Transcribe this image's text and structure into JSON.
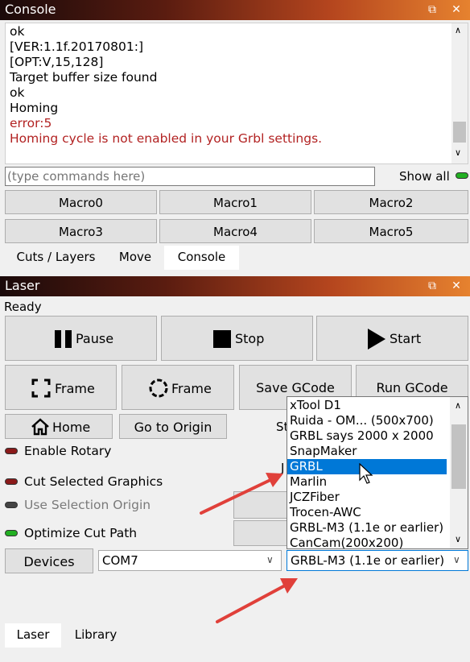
{
  "console": {
    "title": "Console",
    "lines": [
      {
        "text": "ok",
        "color": "#000000"
      },
      {
        "text": "[VER:1.1f.20170801:]",
        "color": "#000000"
      },
      {
        "text": "[OPT:V,15,128]",
        "color": "#000000"
      },
      {
        "text": "Target buffer size found",
        "color": "#000000"
      },
      {
        "text": "ok",
        "color": "#000000"
      },
      {
        "text": "Homing",
        "color": "#000000"
      },
      {
        "text": "error:5",
        "color": "#b22222"
      },
      {
        "text": "Homing cycle is not enabled in your Grbl settings.",
        "color": "#b22222"
      }
    ],
    "input_placeholder": "(type commands here)",
    "show_all_label": "Show all",
    "macros": [
      "Macro0",
      "Macro1",
      "Macro2",
      "Macro3",
      "Macro4",
      "Macro5"
    ],
    "tabs": [
      "Cuts / Layers",
      "Move",
      "Console"
    ],
    "active_tab": "Console"
  },
  "laser": {
    "title": "Laser",
    "status": "Ready",
    "pause_label": "Pause",
    "stop_label": "Stop",
    "start_label": "Start",
    "frame1_label": "Frame",
    "frame2_label": "Frame",
    "save_gcode_label": "Save GCode",
    "run_gcode_label": "Run GCode",
    "home_label": "Home",
    "go_to_origin_label": "Go to Origin",
    "start_from_partial": "St",
    "j_partial": "J",
    "options": [
      {
        "label": "Enable Rotary",
        "state": "off",
        "enabled": true
      },
      {
        "label": "Cut Selected Graphics",
        "state": "off",
        "enabled": true
      },
      {
        "label": "Use Selection Origin",
        "state": "off",
        "enabled": false
      },
      {
        "label": "Optimize Cut Path",
        "state": "on",
        "enabled": true
      }
    ],
    "devices_label": "Devices",
    "port_value": "COM7",
    "device_value": "GRBL-M3 (1.1e or earlier)",
    "device_options": [
      "xTool D1",
      "Ruida - OM... (500x700)",
      "GRBL says 2000 x 2000",
      "SnapMaker",
      "GRBL",
      "Marlin",
      "JCZFiber",
      "Trocen-AWC",
      "GRBL-M3 (1.1e or earlier)",
      "CanCam(200x200)"
    ],
    "highlighted_option": "GRBL",
    "tabs": [
      "Laser",
      "Library"
    ],
    "active_tab": "Laser"
  },
  "colors": {
    "toggle_off": "#8b1a1a",
    "toggle_on": "#22b022",
    "toggle_disabled": "#444444",
    "highlight": "#0078d7",
    "arrow": "#e0403a"
  }
}
